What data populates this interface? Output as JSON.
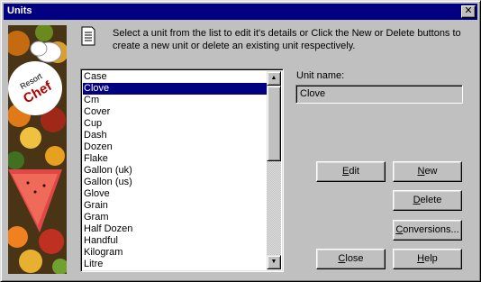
{
  "window": {
    "title": "Units"
  },
  "instructions": "Select a unit from the list to edit it's details or Click the New or Delete buttons to create a new unit or delete an existing unit respectively.",
  "banner": {
    "logo_line1": "Resort",
    "logo_line2": "Chef"
  },
  "list": {
    "items": [
      "Case",
      "Clove",
      "Cm",
      "Cover",
      "Cup",
      "Dash",
      "Dozen",
      "Flake",
      "Gallon (uk)",
      "Gallon (us)",
      "Glove",
      "Grain",
      "Gram",
      "Half Dozen",
      "Handful",
      "Kilogram",
      "Litre"
    ],
    "selected_index": 1
  },
  "unit_name": {
    "label": "Unit name:",
    "value": "Clove"
  },
  "buttons": {
    "edit": {
      "accel": "E",
      "rest": "dit"
    },
    "new": {
      "accel": "N",
      "rest": "ew"
    },
    "delete": {
      "accel": "D",
      "rest": "elete"
    },
    "conversions": {
      "accel": "C",
      "rest": "onversions..."
    },
    "close": {
      "accel": "C",
      "rest": "lose"
    },
    "help": {
      "accel": "H",
      "rest": "elp"
    }
  }
}
